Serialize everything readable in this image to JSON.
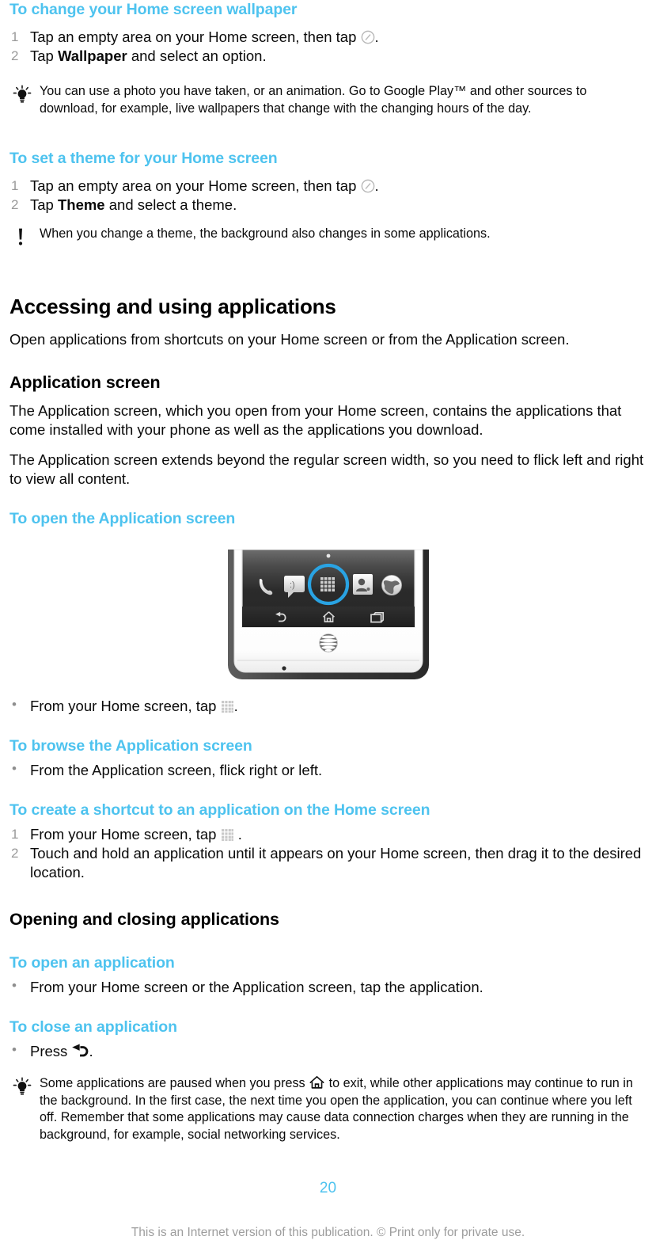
{
  "document": {
    "page_number": "20",
    "footer_note": "This is an Internet version of this publication. © Print only for private use.",
    "accent_color": "#4ec3ef",
    "body_color": "#0a0a0a",
    "muted_color": "#9d9d9d"
  },
  "sections": [
    {
      "id": "change-wallpaper",
      "heading": "To change your Home screen wallpaper",
      "steps": [
        {
          "num": "1",
          "pre": "Tap an empty area on your Home screen, then tap ",
          "icon": "circle-slash-icon",
          "post": "."
        },
        {
          "num": "2",
          "pre": "Tap ",
          "bold": "Wallpaper",
          "post": " and select an option."
        }
      ],
      "note": {
        "icon": "lightbulb-tip-icon",
        "text": "You can use a photo you have taken, or an animation. Go to Google Play™ and other sources to download, for example, live wallpapers that change with the changing hours of the day."
      }
    },
    {
      "id": "set-theme",
      "heading": "To set a theme for your Home screen",
      "steps": [
        {
          "num": "1",
          "pre": "Tap an empty area on your Home screen, then tap ",
          "icon": "circle-slash-icon",
          "post": "."
        },
        {
          "num": "2",
          "pre": "Tap ",
          "bold": "Theme",
          "post": " and select a theme."
        }
      ],
      "note": {
        "icon": "exclamation-note-icon",
        "text": "When you change a theme, the background also changes in some applications."
      }
    }
  ],
  "chapter": {
    "title": "Accessing and using applications",
    "intro": "Open applications from shortcuts on your Home screen or from the Application screen."
  },
  "application_screen": {
    "title": "Application screen",
    "paragraph_1": "The Application screen, which you open from your Home screen, contains the applications that come installed with your phone as well as the applications you download.",
    "paragraph_2": "The Application screen extends beyond the regular screen width, so you need to flick left and right to view all content.",
    "open_heading": "To open the Application screen",
    "open_bullet": {
      "pre": "From your Home screen, tap ",
      "icon": "app-grid-icon",
      "post": "."
    },
    "browse_heading": "To browse the Application screen",
    "browse_bullet": {
      "text": "From the Application screen, flick right or left."
    },
    "shortcut_heading": "To create a shortcut to an application on the Home screen",
    "shortcut_steps": [
      {
        "num": "1",
        "pre": "From your Home screen, tap ",
        "icon": "app-grid-icon",
        "post": " ."
      },
      {
        "num": "2",
        "pre": "Touch and hold an application until it appears on your Home screen, then drag it to the desired location."
      }
    ]
  },
  "phone_illustration": {
    "name": "xperia-phone-home-screen",
    "carrier_logo": "att-logo",
    "dock_icons": [
      "phone-handset-icon",
      "messaging-icon",
      "app-grid-icon",
      "contacts-icon",
      "browser-globe-icon"
    ],
    "highlighted_icon": "app-grid-icon",
    "highlight_color": "#29a3e3",
    "nav_icons": [
      "back-icon",
      "home-icon",
      "recents-icon"
    ]
  },
  "opening_closing": {
    "title": "Opening and closing applications",
    "open_heading": "To open an application",
    "open_bullet": {
      "text": "From your Home screen or the Application screen, tap the application."
    },
    "close_heading": "To close an application",
    "close_bullet": {
      "pre": "Press ",
      "icon": "back-arrow-icon",
      "post": "."
    },
    "note": {
      "icon": "lightbulb-tip-icon",
      "pre": "Some applications are paused when you press ",
      "icon_inline": "home-icon",
      "post": " to exit, while other applications may continue to run in the background. In the first case, the next time you open the application, you can continue where you left off. Remember that some applications may cause data connection charges when they are running in the background, for example, social networking services."
    }
  }
}
